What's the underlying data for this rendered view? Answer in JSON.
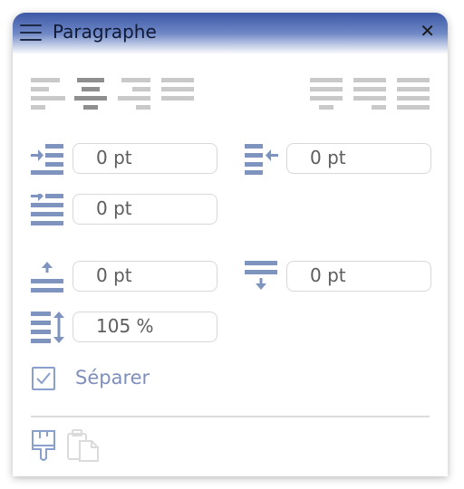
{
  "panel": {
    "title": "Paragraphe",
    "close_glyph": "✕"
  },
  "toolbar": {
    "align_icons": [
      "align-left-icon",
      "align-center-icon",
      "align-right-icon",
      "align-justify-icon"
    ],
    "justify_icons": [
      "justify-last-left-icon",
      "justify-last-right-icon",
      "justify-all-icon"
    ],
    "selected_align": "align-center"
  },
  "indent": {
    "left": "0 pt",
    "right": "0 pt",
    "first_line": "0 pt"
  },
  "spacing": {
    "before": "0 pt",
    "after": "0 pt",
    "line": "105 %"
  },
  "separate": {
    "label": "Séparer",
    "checked": true
  },
  "footer": {
    "icons": [
      "paint-format-icon",
      "paste-format-icon"
    ]
  },
  "colors": {
    "accent": "#7e93bd",
    "header": "#3d59a6",
    "label": "#7f8fbd"
  }
}
